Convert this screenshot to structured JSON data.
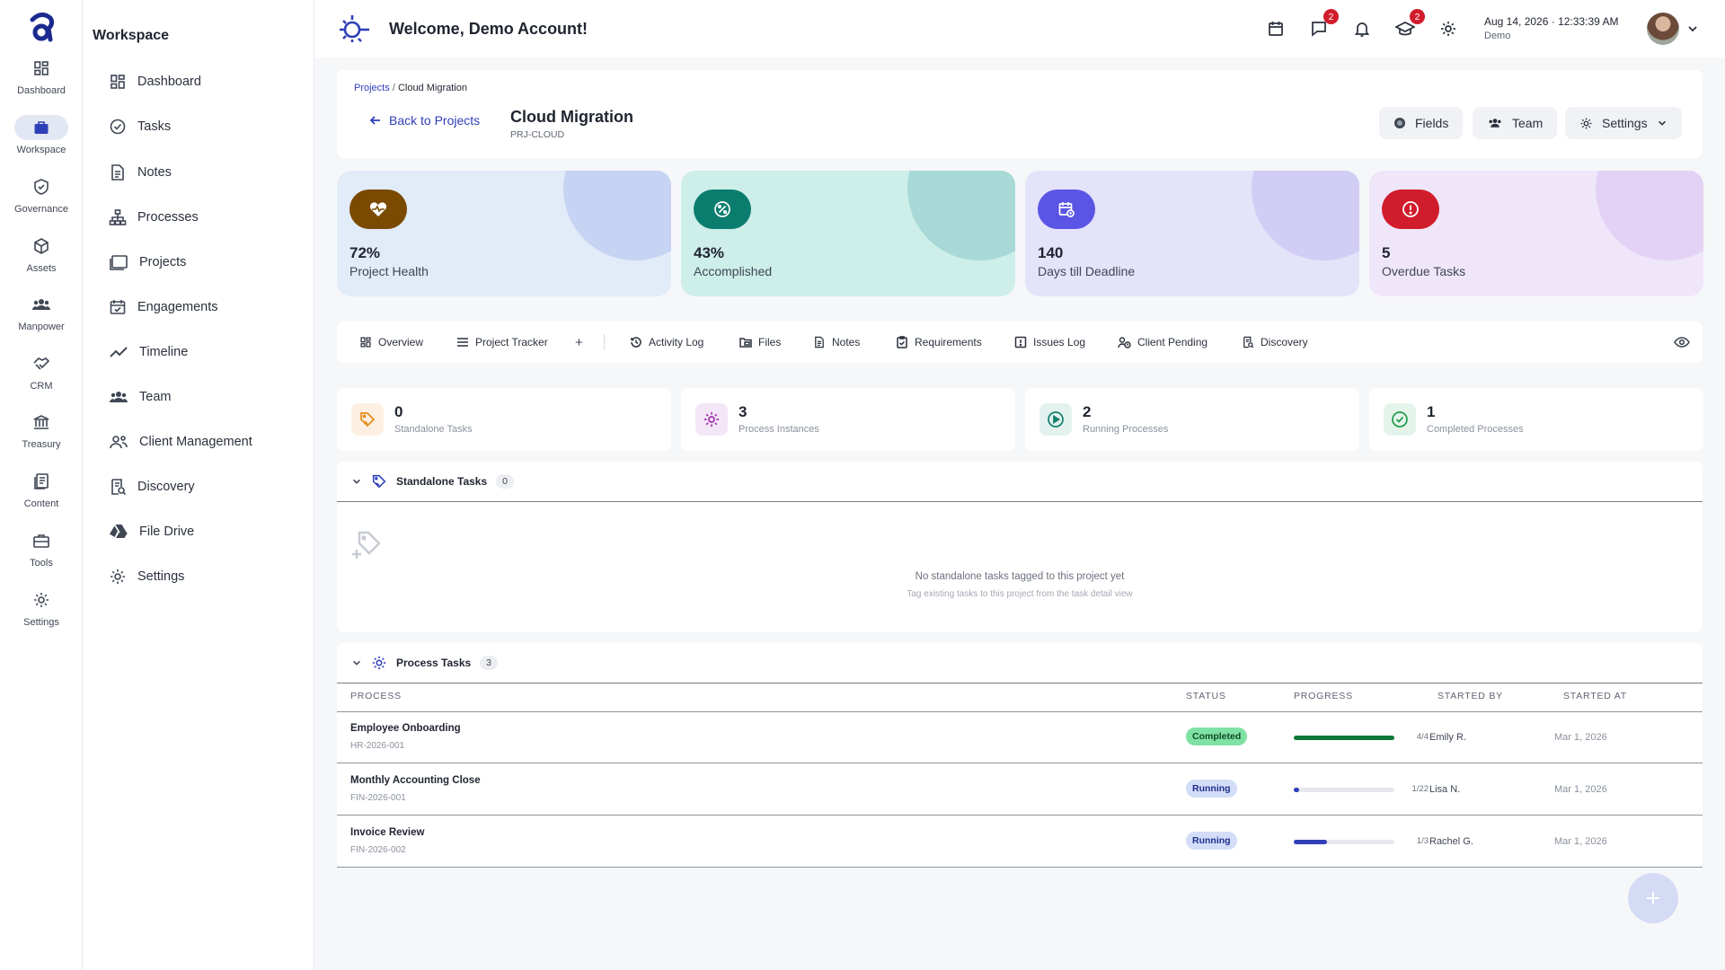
{
  "rail": [
    {
      "label": "Dashboard",
      "icon": "grid-icon"
    },
    {
      "label": "Workspace",
      "icon": "briefcase-icon",
      "active": true
    },
    {
      "label": "Governance",
      "icon": "shield-icon"
    },
    {
      "label": "Assets",
      "icon": "cube-icon"
    },
    {
      "label": "Manpower",
      "icon": "people-icon"
    },
    {
      "label": "CRM",
      "icon": "handshake-icon"
    },
    {
      "label": "Treasury",
      "icon": "bank-icon"
    },
    {
      "label": "Content",
      "icon": "documents-icon"
    },
    {
      "label": "Tools",
      "icon": "toolbox-icon"
    },
    {
      "label": "Settings",
      "icon": "gear-icon"
    }
  ],
  "sidebar": {
    "title": "Workspace",
    "items": [
      {
        "label": "Dashboard",
        "icon": "grid-icon"
      },
      {
        "label": "Tasks",
        "icon": "check-circle-icon"
      },
      {
        "label": "Notes",
        "icon": "note-icon"
      },
      {
        "label": "Processes",
        "icon": "hierarchy-icon"
      },
      {
        "label": "Projects",
        "icon": "folders-icon"
      },
      {
        "label": "Engagements",
        "icon": "calendar-check-icon"
      },
      {
        "label": "Timeline",
        "icon": "trend-icon"
      },
      {
        "label": "Team",
        "icon": "people-icon"
      },
      {
        "label": "Client Management",
        "icon": "client-icon"
      },
      {
        "label": "Discovery",
        "icon": "search-doc-icon"
      },
      {
        "label": "File Drive",
        "icon": "drive-icon"
      },
      {
        "label": "Settings",
        "icon": "gear-icon"
      }
    ]
  },
  "topbar": {
    "welcome": "Welcome, Demo Account!",
    "chat_badge": "2",
    "learning_badge": "2",
    "date": "Aug 14, 2026",
    "time": "12:33:39 AM",
    "user": "Demo"
  },
  "header": {
    "breadcrumb_root": "Projects",
    "breadcrumb_sep": "/",
    "breadcrumb_current": "Cloud Migration",
    "back_label": "Back to Projects",
    "title": "Cloud Migration",
    "code": "PRJ-CLOUD",
    "fields_label": "Fields",
    "team_label": "Team",
    "settings_label": "Settings"
  },
  "stats": [
    {
      "value": "72%",
      "label": "Project Health",
      "bg": "#e2ebf8",
      "blob": "#c7d3f2",
      "icon_bg": "#7a4a00",
      "icon": "heartbeat-icon"
    },
    {
      "value": "43%",
      "label": "Accomplished",
      "bg": "#cdeee9",
      "blob": "#a9d9d6",
      "icon_bg": "#0b7d6e",
      "icon": "percent-icon"
    },
    {
      "value": "140",
      "label": "Days till Deadline",
      "bg": "#e5e3fa",
      "blob": "#d2cdf5",
      "icon_bg": "#5b55e6",
      "icon": "calendar-clock-icon"
    },
    {
      "value": "5",
      "label": "Overdue Tasks",
      "bg": "#f0e6fa",
      "blob": "#e3d2f5",
      "icon_bg": "#d11c2b",
      "icon": "alert-icon"
    }
  ],
  "tabs": [
    {
      "label": "Overview",
      "icon": "grid-icon"
    },
    {
      "label": "Project Tracker",
      "icon": "list-icon"
    },
    {
      "label": "+",
      "icon": "plus-icon"
    },
    {
      "label": "Activity Log",
      "icon": "history-icon"
    },
    {
      "label": "Files",
      "icon": "files-icon"
    },
    {
      "label": "Notes",
      "icon": "note-icon"
    },
    {
      "label": "Requirements",
      "icon": "clipboard-icon"
    },
    {
      "label": "Issues Log",
      "icon": "issue-icon"
    },
    {
      "label": "Client Pending",
      "icon": "client-pending-icon"
    },
    {
      "label": "Discovery",
      "icon": "search-doc-icon"
    }
  ],
  "mini_stats": [
    {
      "value": "0",
      "label": "Standalone Tasks",
      "bg": "#fdf0e3",
      "color": "#e88a1a",
      "icon": "tag-icon"
    },
    {
      "value": "3",
      "label": "Process Instances",
      "bg": "#f3e6f7",
      "color": "#a12fb0",
      "icon": "process-gear-icon"
    },
    {
      "value": "2",
      "label": "Running Processes",
      "bg": "#e3f2ee",
      "color": "#11806d",
      "icon": "play-circle-icon"
    },
    {
      "value": "1",
      "label": "Completed Processes",
      "bg": "#e5f4ea",
      "color": "#1f9a46",
      "icon": "check-circle-icon"
    }
  ],
  "standalone": {
    "title": "Standalone Tasks",
    "count": "0",
    "empty_title": "No standalone tasks tagged to this project yet",
    "empty_hint": "Tag existing tasks to this project from the task detail view"
  },
  "process": {
    "title": "Process Tasks",
    "count": "3",
    "columns": [
      "PROCESS",
      "STATUS",
      "PROGRESS",
      "STARTED BY",
      "STARTED AT"
    ],
    "rows": [
      {
        "name": "Employee Onboarding",
        "code": "HR-2026-001",
        "status": "Completed",
        "status_bg": "#7fe2a4",
        "status_color": "#0d4a24",
        "progress": 1.0,
        "bar_color": "#0d7a3a",
        "fraction": "4/4",
        "started_by": "Emily R.",
        "started_at": "Mar 1, 2026"
      },
      {
        "name": "Monthly Accounting Close",
        "code": "FIN-2026-001",
        "status": "Running",
        "status_bg": "#d3ddf7",
        "status_color": "#1f2f8f",
        "progress": 0.045,
        "bar_color": "#2f3fb8",
        "fraction": "1/22",
        "started_by": "Lisa N.",
        "started_at": "Mar 1, 2026"
      },
      {
        "name": "Invoice Review",
        "code": "FIN-2026-002",
        "status": "Running",
        "status_bg": "#d3ddf7",
        "status_color": "#1f2f8f",
        "progress": 0.333,
        "bar_color": "#2f3fb8",
        "fraction": "1/3",
        "started_by": "Rachel G.",
        "started_at": "Mar 1, 2026"
      }
    ]
  }
}
